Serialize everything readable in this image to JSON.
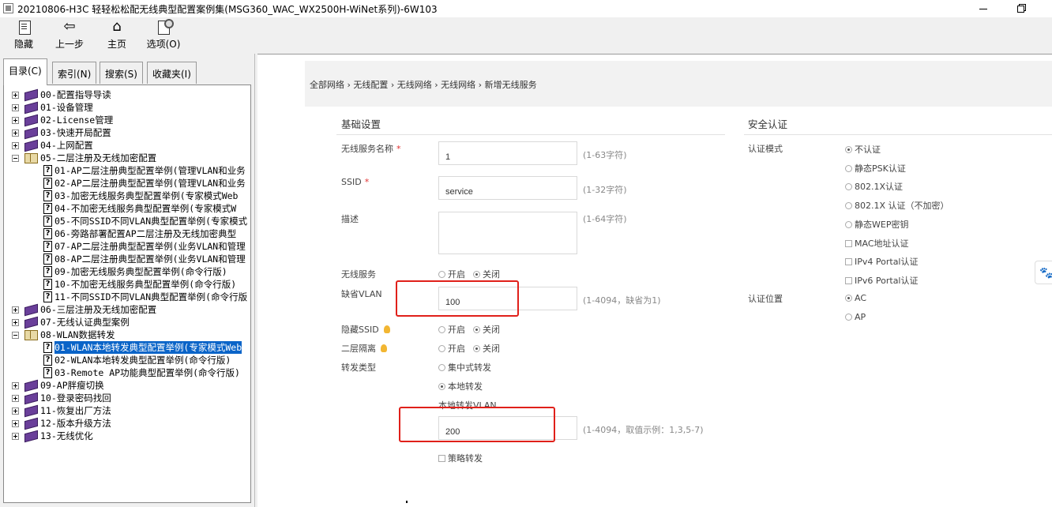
{
  "window": {
    "title": "20210806-H3C 轻轻松松配无线典型配置案例集(MSG360_WAC_WX2500H-WiNet系列)-6W103"
  },
  "toolbar": {
    "hide": "隐藏",
    "back": "上一步",
    "home": "主页",
    "options": "选项(O)"
  },
  "tabs": [
    "目录(C)",
    "索引(N)",
    "搜索(S)",
    "收藏夹(I)"
  ],
  "tree": {
    "items": [
      {
        "label": "00-配置指导导读",
        "type": "book",
        "expanded": false
      },
      {
        "label": "01-设备管理",
        "type": "book",
        "expanded": false
      },
      {
        "label": "02-License管理",
        "type": "book",
        "expanded": false
      },
      {
        "label": "03-快速开局配置",
        "type": "book",
        "expanded": false
      },
      {
        "label": "04-上网配置",
        "type": "book",
        "expanded": false
      },
      {
        "label": "05-二层注册及无线加密配置",
        "type": "book",
        "expanded": true
      },
      {
        "label": "01-AP二层注册典型配置举例(管理VLAN和业务",
        "type": "page"
      },
      {
        "label": "02-AP二层注册典型配置举例(管理VLAN和业务",
        "type": "page"
      },
      {
        "label": "03-加密无线服务典型配置举例(专家模式Web",
        "type": "page"
      },
      {
        "label": "04-不加密无线服务典型配置举例(专家模式W",
        "type": "page"
      },
      {
        "label": "05-不同SSID不同VLAN典型配置举例(专家模式",
        "type": "page"
      },
      {
        "label": "06-旁路部署配置AP二层注册及无线加密典型",
        "type": "page"
      },
      {
        "label": "07-AP二层注册典型配置举例(业务VLAN和管理",
        "type": "page"
      },
      {
        "label": "08-AP二层注册典型配置举例(业务VLAN和管理",
        "type": "page"
      },
      {
        "label": "09-加密无线服务典型配置举例(命令行版)",
        "type": "page"
      },
      {
        "label": "10-不加密无线服务典型配置举例(命令行版)",
        "type": "page"
      },
      {
        "label": "11-不同SSID不同VLAN典型配置举例(命令行版",
        "type": "page"
      },
      {
        "label": "06-三层注册及无线加密配置",
        "type": "book",
        "expanded": false
      },
      {
        "label": "07-无线认证典型案例",
        "type": "book",
        "expanded": false
      },
      {
        "label": "08-WLAN数据转发",
        "type": "book",
        "expanded": true
      },
      {
        "label": "01-WLAN本地转发典型配置举例(专家模式Web",
        "type": "page",
        "selected": true
      },
      {
        "label": "02-WLAN本地转发典型配置举例(命令行版)",
        "type": "page"
      },
      {
        "label": "03-Remote AP功能典型配置举例(命令行版)",
        "type": "page"
      },
      {
        "label": "09-AP胖瘦切换",
        "type": "book",
        "expanded": false
      },
      {
        "label": "10-登录密码找回",
        "type": "book",
        "expanded": false
      },
      {
        "label": "11-恢复出厂方法",
        "type": "book",
        "expanded": false
      },
      {
        "label": "12-版本升级方法",
        "type": "book",
        "expanded": false
      },
      {
        "label": "13-无线优化",
        "type": "book",
        "expanded": false
      }
    ]
  },
  "breadcrumb": [
    "全部网络",
    "无线配置",
    "无线网络",
    "无线网络",
    "新增无线服务"
  ],
  "basic": {
    "title": "基础设置",
    "service_name_label": "无线服务名称",
    "service_name_value": "1",
    "service_name_hint": "(1-63字符)",
    "ssid_label": "SSID",
    "ssid_value": "service",
    "ssid_hint": "(1-32字符)",
    "desc_label": "描述",
    "desc_hint": "(1-64字符)",
    "wireless_service_label": "无线服务",
    "on": "开启",
    "off": "关闭",
    "default_vlan_label": "缺省VLAN",
    "default_vlan_value": "100",
    "default_vlan_hint": "(1-4094，缺省为1)",
    "hide_ssid_label": "隐藏SSID",
    "l2_isolation_label": "二层隔离",
    "forward_type_label": "转发类型",
    "central_forward": "集中式转发",
    "local_forward": "本地转发",
    "local_vlan_label": "本地转发VLAN",
    "local_vlan_value": "200",
    "local_vlan_hint": "(1-4094，取值示例：1,3,5-7)",
    "policy_forward": "策略转发"
  },
  "security": {
    "title": "安全认证",
    "auth_mode_label": "认证模式",
    "auth_modes": [
      {
        "label": "不认证",
        "kind": "radio",
        "checked": true
      },
      {
        "label": "静态PSK认证",
        "kind": "radio",
        "checked": false
      },
      {
        "label": "802.1X认证",
        "kind": "radio",
        "checked": false
      },
      {
        "label": "802.1X 认证（不加密）",
        "kind": "radio",
        "checked": false
      },
      {
        "label": "静态WEP密钥",
        "kind": "radio",
        "checked": false
      },
      {
        "label": "MAC地址认证",
        "kind": "checkbox",
        "checked": false
      },
      {
        "label": "IPv4 Portal认证",
        "kind": "checkbox",
        "checked": false
      },
      {
        "label": "IPv6 Portal认证",
        "kind": "checkbox",
        "checked": false
      }
    ],
    "auth_location_label": "认证位置",
    "auth_locations": [
      {
        "label": "AC",
        "checked": true
      },
      {
        "label": "AP",
        "checked": false
      }
    ]
  },
  "icons": {
    "help_float": "paw-icon"
  }
}
